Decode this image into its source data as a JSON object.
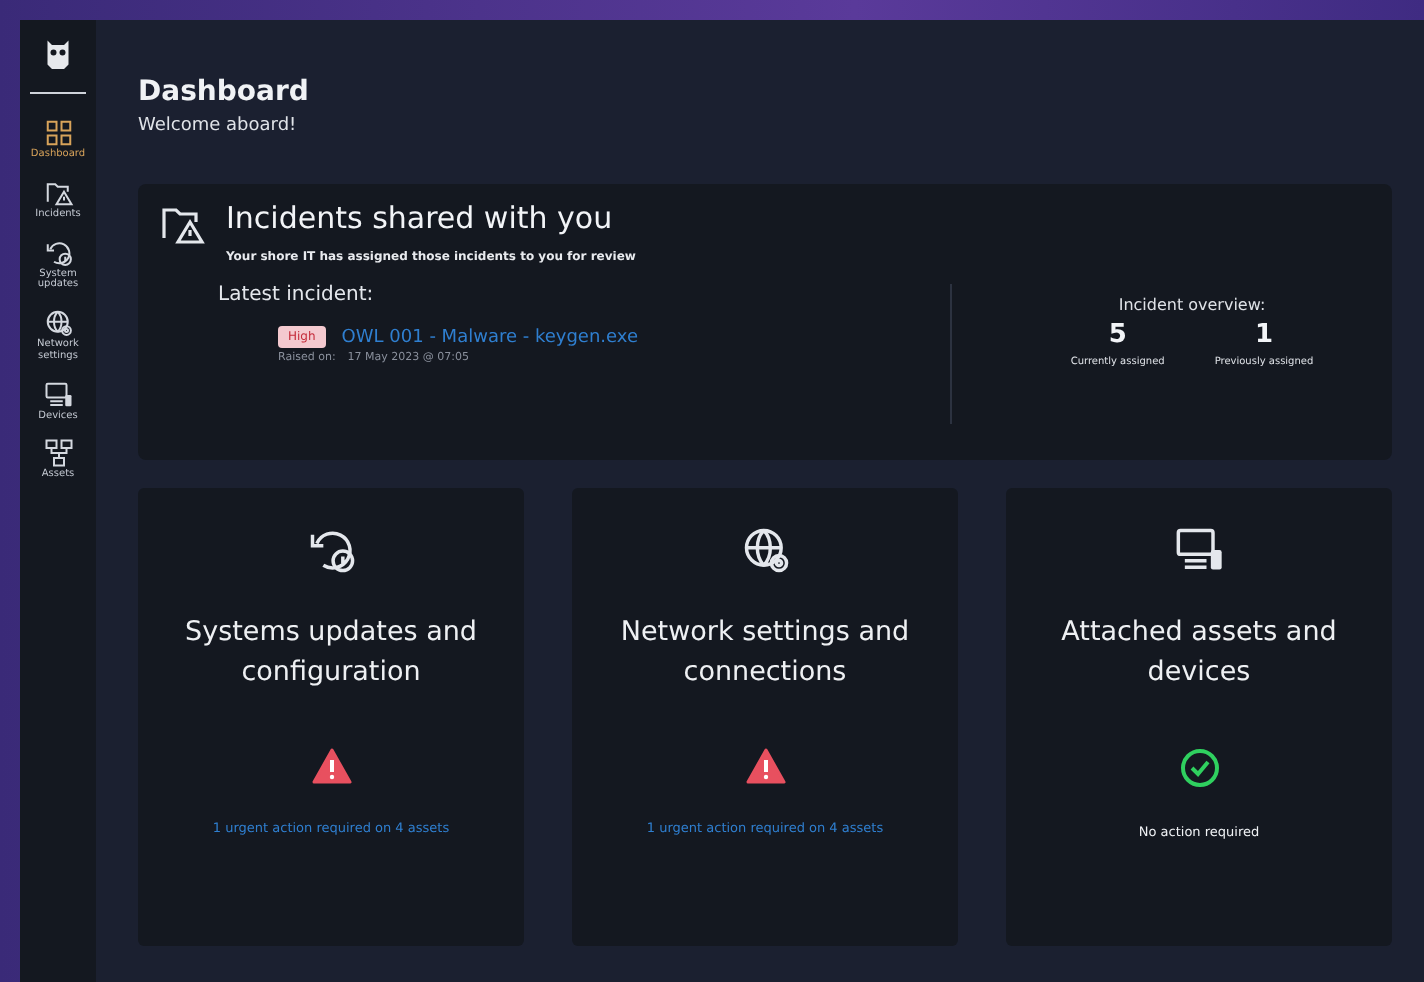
{
  "sidebar": {
    "items": [
      {
        "label": "Dashboard",
        "selected": true
      },
      {
        "label": "Incidents",
        "selected": false
      },
      {
        "label": "System updates",
        "selected": false
      },
      {
        "label": "Network settings",
        "selected": false
      },
      {
        "label": "Devices",
        "selected": false
      },
      {
        "label": "Assets",
        "selected": false
      }
    ]
  },
  "header": {
    "title": "Dashboard",
    "subtitle": "Welcome aboard!"
  },
  "incidents": {
    "title": "Incidents shared with you",
    "subtitle": "Your shore IT has assigned those incidents to you for review",
    "latest_label": "Latest incident:",
    "severity": "High",
    "incident_link": "OWL 001 - Malware - keygen.exe",
    "raised_label": "Raised on:",
    "raised_date": "17 May 2023 @ 07:05",
    "overview_title": "Incident overview:",
    "stats": [
      {
        "value": "5",
        "label": "Currently assigned"
      },
      {
        "value": "1",
        "label": "Previously assigned"
      }
    ]
  },
  "cards": [
    {
      "title": "Systems updates and configuration",
      "kind": "warning",
      "status": "1 urgent action required on 4 assets"
    },
    {
      "title": "Network settings and connections",
      "kind": "warning",
      "status": "1 urgent action required on 4 assets"
    },
    {
      "title": "Attached assets and devices",
      "kind": "ok",
      "status": "No action required"
    }
  ]
}
